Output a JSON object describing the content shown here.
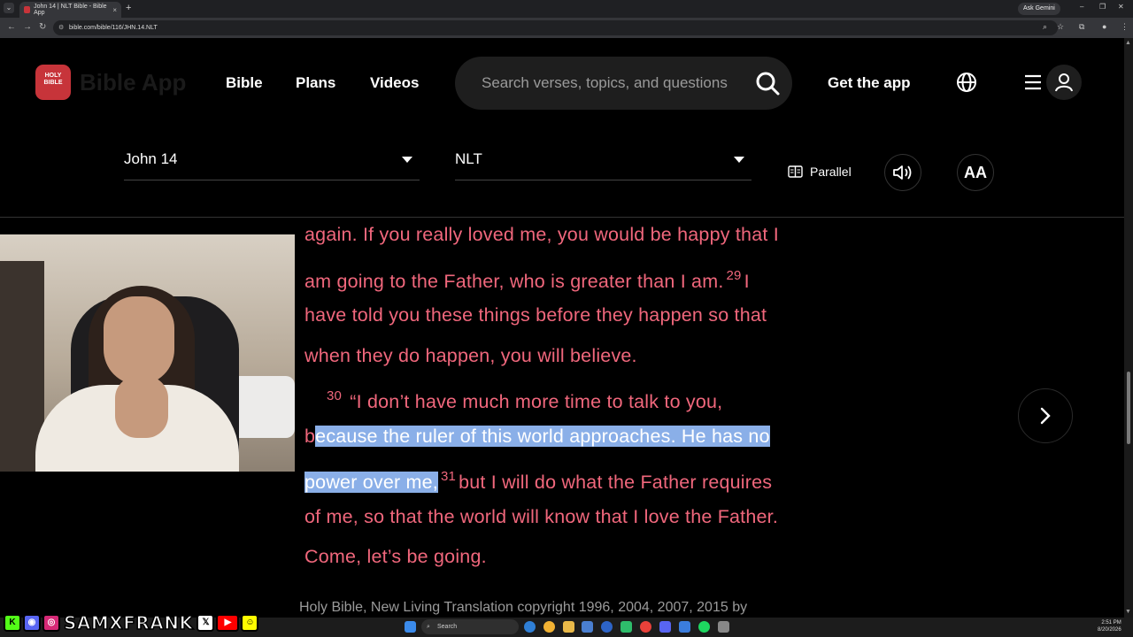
{
  "browser": {
    "tab_title": "John 14 | NLT Bible - Bible App",
    "tab_close": "×",
    "new_tab": "+",
    "url": "bible.com/bible/116/JHN.14.NLT",
    "gemini_label": "Ask Gemini"
  },
  "header": {
    "logo_text": "HOLY BIBLE",
    "app_name": "Bible App",
    "nav": [
      "Bible",
      "Plans",
      "Videos"
    ],
    "search_placeholder": "Search verses, topics, and questions",
    "get_app": "Get the app"
  },
  "controls": {
    "book_chapter": "John 14",
    "version": "NLT",
    "parallel_label": "Parallel",
    "font_size_label": "AA"
  },
  "scripture": {
    "line1": "again. If you really loved me, you would be happy that I",
    "line2_a": "am going to the Father, who is greater than I am.",
    "verse29": "29",
    "line2_b": "I",
    "line3": "have told you these things before they happen so that",
    "line4": "when they do happen, you will believe.",
    "verse30": "30",
    "line5": "“I don’t have much more time to talk to you,",
    "line6_a": "b",
    "line6_hl": "ecause the ruler of this world approaches. He has no",
    "line7_hl": "power over me,",
    "verse31": "31",
    "line7_b": "but I will do what the Father requires",
    "line8": "of me, so that the world will know that I love the Father.",
    "line9": "Come, let’s be going.",
    "highlight_color": "#8aafe8",
    "text_color": "#f0677c"
  },
  "copyright": "Holy Bible, New Living Translation copyright 1996, 2004, 2007, 2015 by",
  "taskbar": {
    "search_label": "Search",
    "time": "2:51 PM",
    "date": "8/20/2026"
  },
  "overlay": {
    "brand": "SAMXFRANK",
    "x_label": "𝕏",
    "k_label": "K"
  }
}
